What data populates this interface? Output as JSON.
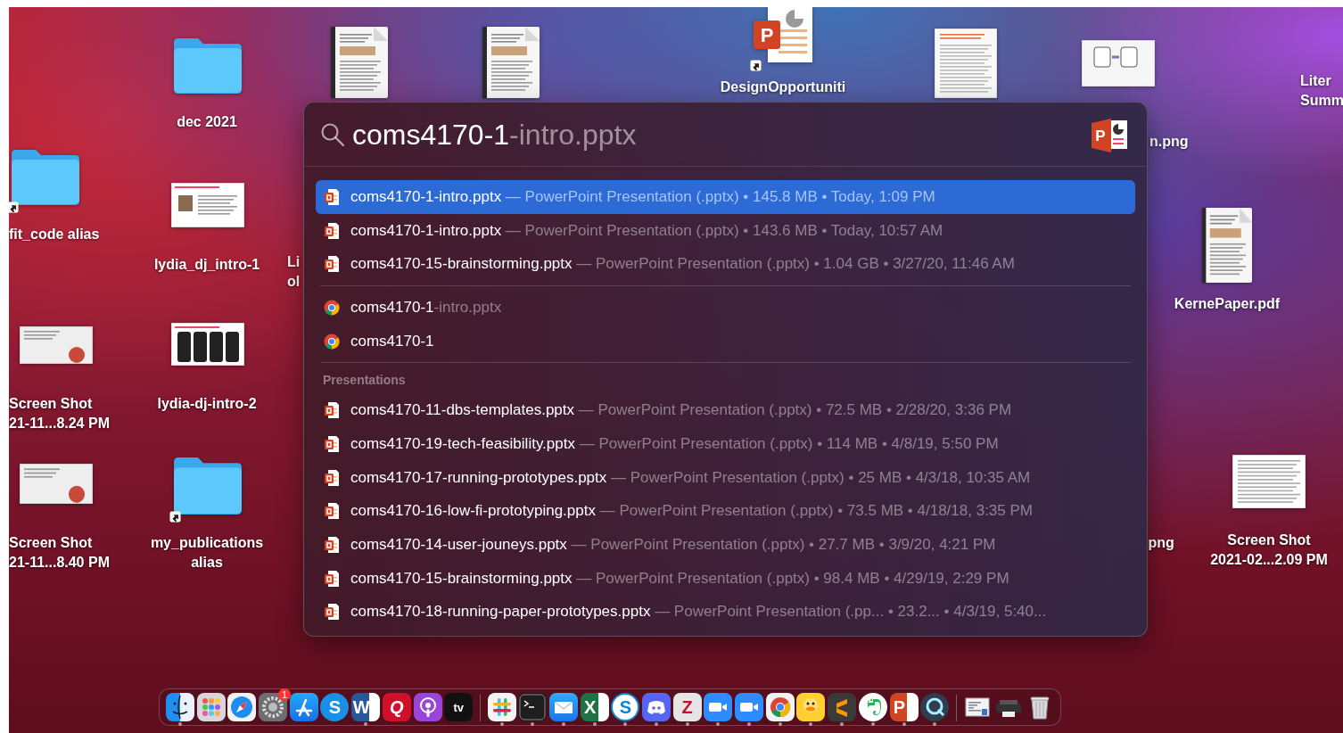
{
  "desktop": {
    "icons": [
      {
        "kind": "folder",
        "label": "dec 2021",
        "alias": false
      },
      {
        "kind": "document",
        "alias": false
      },
      {
        "kind": "document",
        "alias": false
      },
      {
        "kind": "presentation",
        "label": "DesignOpportuniti",
        "glyph": "P",
        "alias": true
      },
      {
        "kind": "table-document",
        "alias": false
      },
      {
        "kind": "diagram",
        "alias": false
      },
      {
        "kind": "label-only",
        "label": "Liter Summ",
        "alias": false
      },
      {
        "kind": "label-only",
        "label": "n.png",
        "alias": false
      },
      {
        "kind": "folder",
        "label": "fit_code alias",
        "alias": true
      },
      {
        "kind": "slide",
        "label": "lydia_dj_intro-1",
        "alias": false
      },
      {
        "kind": "label-only",
        "label": "Li ol",
        "alias": false
      },
      {
        "kind": "screenshot",
        "label": "Screen Shot 21-11...8.24 PM",
        "alias": false
      },
      {
        "kind": "phones-slide",
        "label": "lydia-dj-intro-2",
        "alias": false
      },
      {
        "kind": "screenshot",
        "label": "Screen Shot 21-11...8.40 PM",
        "alias": false
      },
      {
        "kind": "folder",
        "label": "my_publications alias",
        "alias": true
      },
      {
        "kind": "document",
        "label": "KernePaper.pdf",
        "alias": false
      },
      {
        "kind": "label-only",
        "label": ".png",
        "alias": false
      },
      {
        "kind": "list-screenshot",
        "label": "Screen Shot 2021-02...2.09 PM",
        "alias": false
      }
    ]
  },
  "spotlight": {
    "query": "coms4170-1",
    "completion": "-intro.pptx",
    "app_glyph": "P",
    "sections": [
      {
        "items": [
          {
            "kind": "file",
            "name": "coms4170-1-intro.pptx",
            "detail": "— PowerPoint Presentation (.pptx) • 145.8 MB • Today, 1:09 PM",
            "selected": true
          },
          {
            "kind": "file",
            "name": "coms4170-1-intro.pptx",
            "detail": "— PowerPoint Presentation (.pptx) • 143.6 MB • Today, 10:57 AM",
            "selected": false
          },
          {
            "kind": "file",
            "name": "coms4170-15-brainstorming.pptx",
            "detail": "— PowerPoint Presentation (.pptx) • 1.04 GB • 3/27/20, 11:46 AM",
            "selected": false
          }
        ]
      },
      {
        "items": [
          {
            "kind": "web",
            "name": "coms4170-1",
            "suffix": "-intro.pptx",
            "selected": false
          },
          {
            "kind": "web",
            "name": "coms4170-1",
            "selected": false
          }
        ]
      },
      {
        "header": "Presentations",
        "items": [
          {
            "kind": "file",
            "name": "coms4170-11-dbs-templates.pptx",
            "detail": "— PowerPoint Presentation (.pptx) • 72.5 MB • 2/28/20, 3:36 PM",
            "selected": false
          },
          {
            "kind": "file",
            "name": "coms4170-19-tech-feasibility.pptx",
            "detail": "— PowerPoint Presentation (.pptx) • 114 MB • 4/8/19, 5:50 PM",
            "selected": false
          },
          {
            "kind": "file",
            "name": "coms4170-17-running-prototypes.pptx",
            "detail": "— PowerPoint Presentation (.pptx) • 25 MB • 4/3/18, 10:35 AM",
            "selected": false
          },
          {
            "kind": "file",
            "name": "coms4170-16-low-fi-prototyping.pptx",
            "detail": "— PowerPoint Presentation (.pptx) • 73.5 MB • 4/18/18, 3:35 PM",
            "selected": false
          },
          {
            "kind": "file",
            "name": "coms4170-14-user-jouneys.pptx",
            "detail": "— PowerPoint Presentation (.pptx) • 27.7 MB • 3/9/20, 4:21 PM",
            "selected": false
          },
          {
            "kind": "file",
            "name": "coms4170-15-brainstorming.pptx",
            "detail": "— PowerPoint Presentation (.pptx) • 98.4 MB • 4/29/19, 2:29 PM",
            "selected": false
          },
          {
            "kind": "file",
            "name": "coms4170-18-running-paper-prototypes.pptx",
            "detail": "— PowerPoint Presentation (.pp... • 23.2... • 4/3/19, 5:40...",
            "selected": false
          }
        ]
      }
    ]
  },
  "dock": {
    "groups": [
      [
        {
          "kind": "finder",
          "running": true
        },
        {
          "kind": "launchpad",
          "running": false
        },
        {
          "kind": "safari",
          "running": false
        },
        {
          "kind": "settings",
          "running": false,
          "badge": "1"
        },
        {
          "kind": "appstore",
          "running": false
        },
        {
          "kind": "s-circle",
          "glyph": "S",
          "running": false
        },
        {
          "kind": "word",
          "glyph": "W",
          "running": true
        },
        {
          "kind": "q-app",
          "glyph": "Q",
          "running": false
        },
        {
          "kind": "podcasts",
          "running": false
        },
        {
          "kind": "tv",
          "glyph": "tv",
          "running": false
        }
      ],
      [
        {
          "kind": "slack",
          "running": true
        },
        {
          "kind": "terminal",
          "running": true
        },
        {
          "kind": "mail",
          "running": true
        },
        {
          "kind": "excel",
          "glyph": "X",
          "running": true
        },
        {
          "kind": "skype",
          "glyph": "S",
          "running": true
        },
        {
          "kind": "discord",
          "running": true
        },
        {
          "kind": "z-app",
          "glyph": "Z",
          "running": true
        },
        {
          "kind": "zoom",
          "running": true
        },
        {
          "kind": "zoom",
          "running": true
        },
        {
          "kind": "chrome",
          "running": true
        },
        {
          "kind": "duck",
          "running": true
        },
        {
          "kind": "sublime",
          "running": true
        },
        {
          "kind": "evernote",
          "running": true
        },
        {
          "kind": "powerpoint",
          "glyph": "P",
          "running": true
        },
        {
          "kind": "quicktime",
          "running": true
        }
      ],
      [
        {
          "kind": "preview",
          "running": false
        },
        {
          "kind": "printer",
          "running": false
        },
        {
          "kind": "trash",
          "running": false
        }
      ]
    ]
  }
}
